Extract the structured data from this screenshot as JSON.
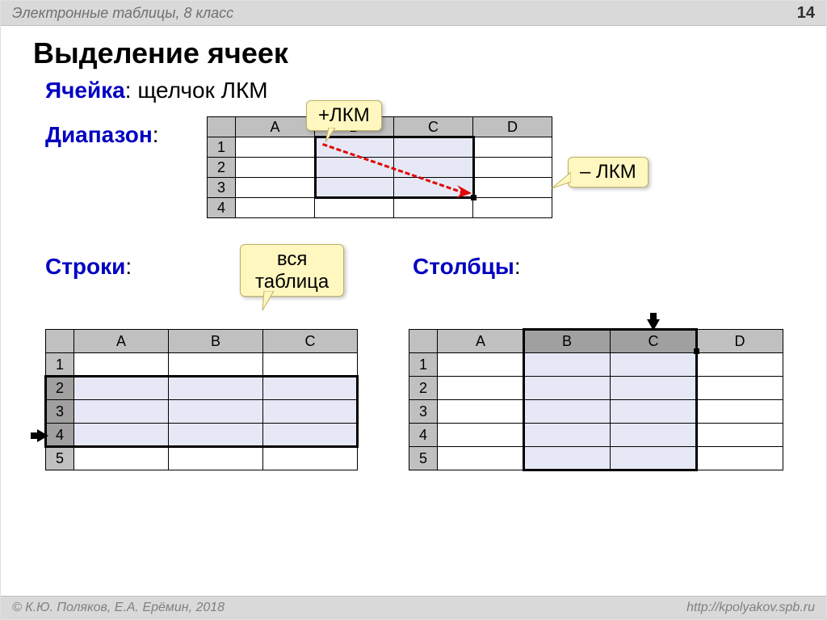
{
  "header": {
    "subject": "Электронные таблицы, 8 класс",
    "page_number": "14"
  },
  "footer": {
    "copyright": "© К.Ю. Поляков, Е.А. Ерёмин, 2018",
    "url": "http://kpolyakov.spb.ru"
  },
  "title": "Выделение ячеек",
  "labels": {
    "cell_term": "Ячейка",
    "cell_action": ": щелчок ЛКМ",
    "range_term": "Диапазон",
    "range_colon": ":",
    "rows_term": "Строки",
    "rows_colon": ":",
    "cols_term": "Столбцы",
    "cols_colon": ":"
  },
  "callouts": {
    "plus_lkm": "+ЛКМ",
    "minus_lkm": "– ЛКМ",
    "whole_table_l1": "вся",
    "whole_table_l2": "таблица"
  },
  "sheet_range": {
    "cols": [
      "A",
      "B",
      "C",
      "D"
    ],
    "rows": [
      "1",
      "2",
      "3",
      "4"
    ]
  },
  "sheet_rows": {
    "cols": [
      "A",
      "B",
      "C"
    ],
    "rows": [
      "1",
      "2",
      "3",
      "4",
      "5"
    ]
  },
  "sheet_cols": {
    "cols": [
      "A",
      "B",
      "C",
      "D"
    ],
    "rows": [
      "1",
      "2",
      "3",
      "4",
      "5"
    ]
  }
}
